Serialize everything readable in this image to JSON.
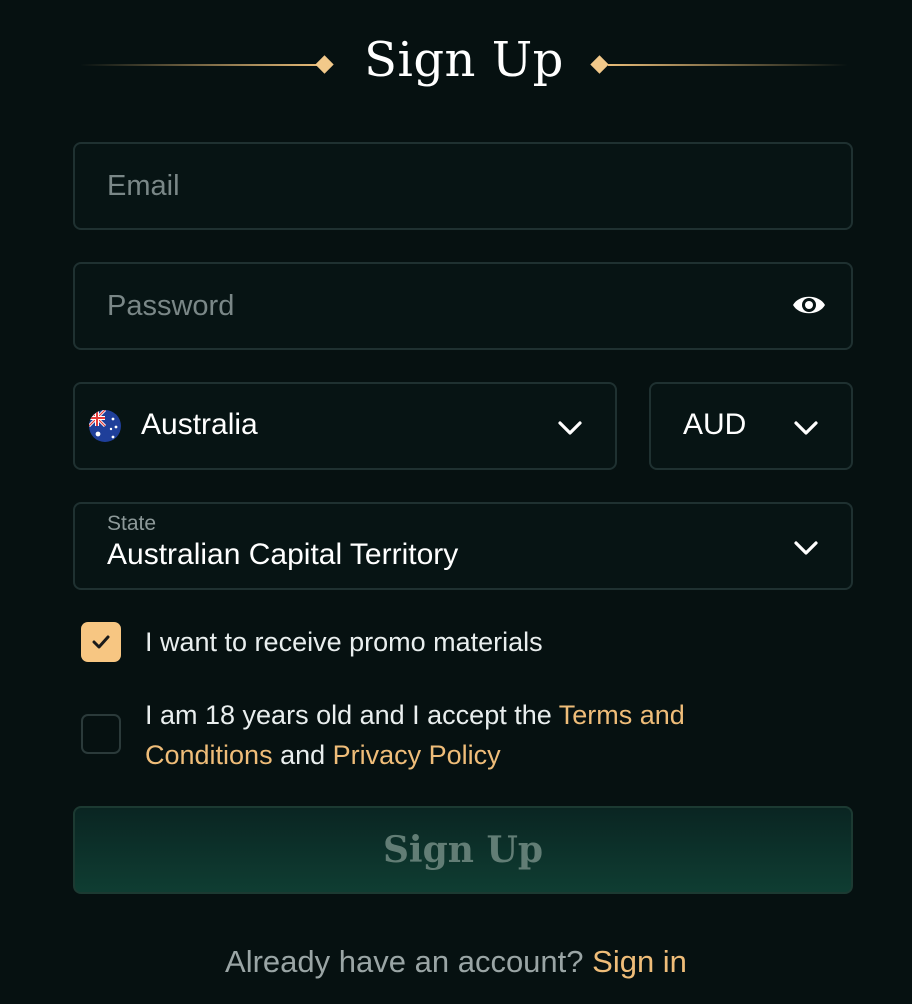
{
  "header": {
    "title": "Sign Up"
  },
  "form": {
    "email_placeholder": "Email",
    "password_placeholder": "Password",
    "country": {
      "value": "Australia",
      "flag": "australia-flag"
    },
    "currency": {
      "value": "AUD"
    },
    "state": {
      "label": "State",
      "value": "Australian Capital Territory"
    },
    "promo": {
      "label": "I want to receive promo materials",
      "checked": true
    },
    "terms": {
      "prefix": "I am 18 years old and I accept the ",
      "terms_link": "Terms and Conditions",
      "middle": " and ",
      "privacy_link": "Privacy Policy",
      "checked": false
    },
    "submit_label": "Sign Up"
  },
  "footer": {
    "prompt": "Already have an account?",
    "sign_in_link": "Sign in"
  },
  "colors": {
    "accent": "#efbd79",
    "background": "#061111",
    "field_border": "#1f3131",
    "button": "#0f3d32"
  }
}
